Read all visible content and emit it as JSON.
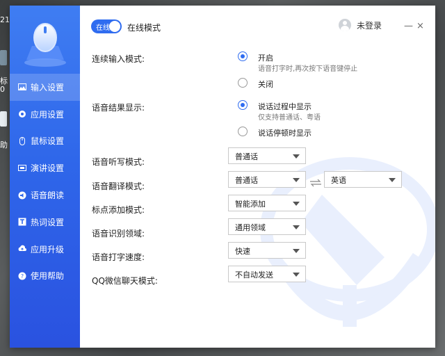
{
  "desktop": {
    "frag1": "21",
    "frag2": "标",
    "frag3": "0",
    "frag4": "助"
  },
  "header": {
    "toggle_label": "在线",
    "mode_label": "在线模式",
    "user_label": "未登录",
    "minimize": "—",
    "close": "×"
  },
  "sidebar": {
    "items": [
      {
        "label": "输入设置",
        "icon": "image-icon",
        "active": true
      },
      {
        "label": "应用设置",
        "icon": "gear-icon"
      },
      {
        "label": "鼠标设置",
        "icon": "mouse-icon"
      },
      {
        "label": "演讲设置",
        "icon": "presentation-icon"
      },
      {
        "label": "语音朗读",
        "icon": "speaker-icon"
      },
      {
        "label": "热词设置",
        "icon": "text-icon"
      },
      {
        "label": "应用升级",
        "icon": "cloud-upload-icon"
      },
      {
        "label": "使用帮助",
        "icon": "question-icon"
      }
    ]
  },
  "settings": {
    "continuous": {
      "label": "连续输入模式:",
      "on_label": "开启",
      "on_desc": "语音打字时,再次按下语音键停止",
      "off_label": "关闭"
    },
    "result_display": {
      "label": "语音结果显示:",
      "opt1_label": "说话过程中显示",
      "opt1_desc": "仅支持普通话、粤语",
      "opt2_label": "说话停顿时显示"
    },
    "dictation": {
      "label": "语音听写模式:",
      "value": "普通话"
    },
    "translation": {
      "label": "语音翻译模式:",
      "from": "普通话",
      "to": "英语"
    },
    "punctuation": {
      "label": "标点添加模式:",
      "value": "智能添加"
    },
    "domain": {
      "label": "语音识别领域:",
      "value": "通用领域"
    },
    "speed": {
      "label": "语音打字速度:",
      "value": "快速"
    },
    "qq": {
      "label": "QQ微信聊天模式:",
      "value": "不自动发送"
    }
  },
  "colors": {
    "accent": "#2f6cf0",
    "sidebar_top": "#3f7df2",
    "sidebar_bottom": "#2a52e0"
  }
}
